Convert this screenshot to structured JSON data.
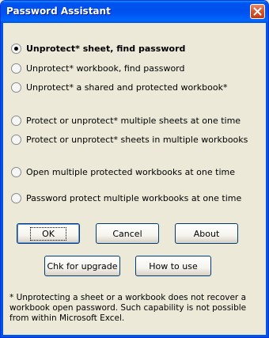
{
  "window": {
    "title": "Password Assistant"
  },
  "options": [
    {
      "label": "Unprotect* sheet, find password",
      "selected": true
    },
    {
      "label": "Unprotect* workbook, find password",
      "selected": false
    },
    {
      "label": "Unprotect* a shared and protected workbook*",
      "selected": false
    },
    {
      "label": "Protect or unprotect* multiple sheets at one time",
      "selected": false
    },
    {
      "label": "Protect or unprotect* sheets in multiple workbooks",
      "selected": false
    },
    {
      "label": "Open multiple protected workbooks at one time",
      "selected": false
    },
    {
      "label": "Password protect multiple workbooks at one time",
      "selected": false
    }
  ],
  "buttons": {
    "ok": "OK",
    "cancel": "Cancel",
    "about": "About",
    "upgrade": "Chk for upgrade",
    "how_to_use": "How to use"
  },
  "note": {
    "line1": "* Unprotecting a sheet or a workbook does not recover a",
    "line2": "workbook open password.  Such capability is not possible",
    "line3": "from within Microsoft Excel."
  },
  "colors": {
    "titlebar": "#0055E5",
    "dialog_bg": "#ECE9D8",
    "close_button": "#D4552F"
  },
  "icons": {
    "close": "close-x-icon"
  }
}
